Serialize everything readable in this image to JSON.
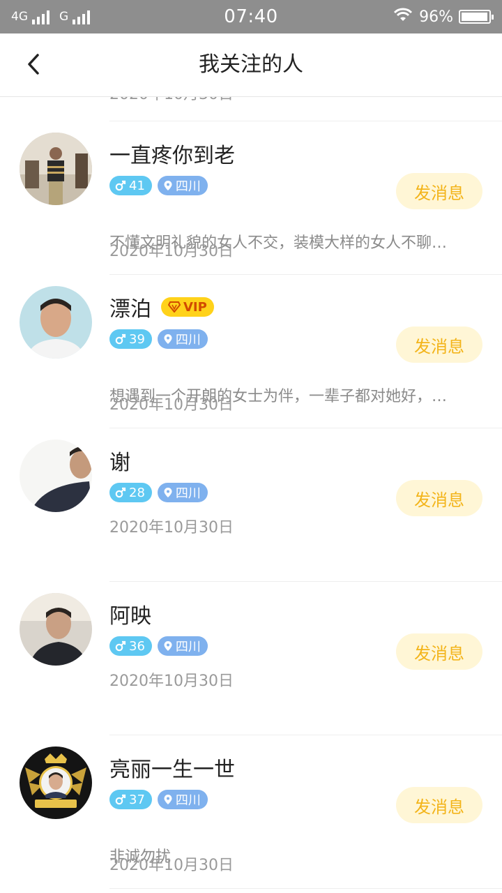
{
  "status_bar": {
    "network_1": "4G",
    "network_2": "G",
    "time": "07:40",
    "battery_percent": "96%",
    "wifi_icon": "wifi-icon",
    "battery_level": 0.96
  },
  "navbar": {
    "title": "我关注的人",
    "back_icon": "chevron-left-icon"
  },
  "list": {
    "partial_date": "2020年10月30日",
    "button_label": "发消息",
    "items": [
      {
        "name": "一直疼你到老",
        "vip": false,
        "age": "41",
        "location": "四川",
        "bio": "不懂文明礼貌的女人不交，装模大样的女人不聊…",
        "date": "2020年10月30日"
      },
      {
        "name": "漂泊",
        "vip": true,
        "vip_label": "VIP",
        "age": "39",
        "location": "四川",
        "bio": "想遇到一个开朗的女士为伴，一辈子都对她好，…",
        "date": "2020年10月30日"
      },
      {
        "name": "谢",
        "vip": false,
        "age": "28",
        "location": "四川",
        "bio": "",
        "date": "2020年10月30日"
      },
      {
        "name": "阿映",
        "vip": false,
        "age": "36",
        "location": "四川",
        "bio": "",
        "date": "2020年10月30日"
      },
      {
        "name": "亮丽一生一世",
        "vip": false,
        "age": "37",
        "location": "四川",
        "bio": "非诚勿扰",
        "date": "2020年10月30日"
      }
    ]
  },
  "colors": {
    "status_bar_bg": "#8e8e8e",
    "button_bg": "#fff6d6",
    "button_text": "#f3b41a",
    "age_tag": "#5ec8f2",
    "location_tag": "#7fb1ee",
    "vip_bg": "#ffd21a"
  }
}
